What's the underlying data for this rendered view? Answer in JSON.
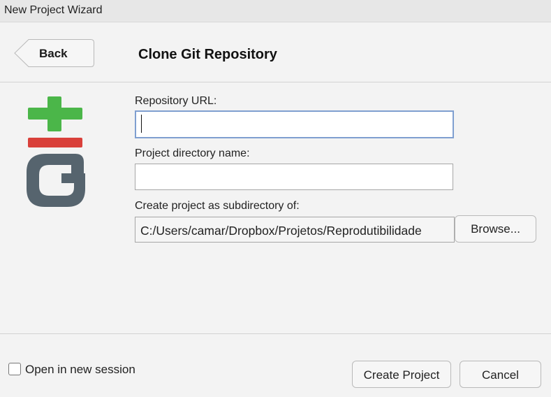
{
  "window": {
    "title": "New Project Wizard"
  },
  "header": {
    "back_label": "Back",
    "title": "Clone Git Repository"
  },
  "logo": {
    "icon": "git-logo-icon",
    "colors": {
      "plus": "#4bb649",
      "bar": "#d9403a",
      "g": "#56646e"
    }
  },
  "form": {
    "repo_url_label": "Repository URL:",
    "repo_url_value": "",
    "dir_name_label": "Project directory name:",
    "dir_name_value": "",
    "subdir_label": "Create project as subdirectory of:",
    "subdir_value": "C:/Users/camar/Dropbox/Projetos/Reprodutibilidade",
    "browse_label": "Browse..."
  },
  "footer": {
    "open_new_session_label": "Open in new session",
    "open_new_session_checked": false,
    "create_label": "Create Project",
    "cancel_label": "Cancel"
  }
}
